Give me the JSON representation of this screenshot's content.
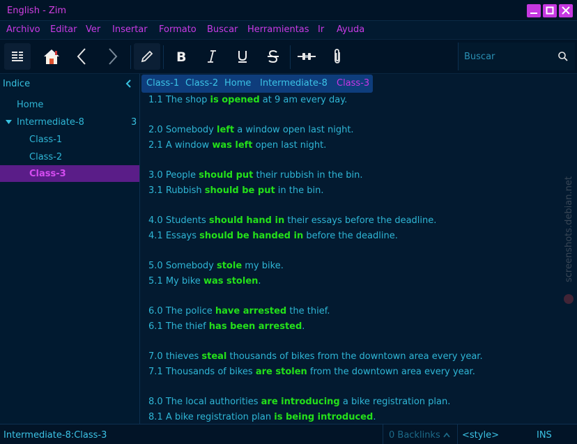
{
  "window": {
    "title": "English - Zim"
  },
  "menu": [
    "Archivo",
    "Editar",
    "Ver",
    "Insertar",
    "Formato",
    "Buscar",
    "Herramientas",
    "Ir",
    "Ayuda"
  ],
  "search": {
    "placeholder": "Buscar"
  },
  "sidebar": {
    "title": "Indice",
    "items": [
      {
        "label": "Home"
      },
      {
        "label": "Intermediate-8",
        "count": "3"
      },
      {
        "label": "Class-1"
      },
      {
        "label": "Class-2"
      },
      {
        "label": "Class-3"
      }
    ]
  },
  "pathbar": [
    "Class-1",
    "Class-2",
    "Home",
    "Intermediate-8",
    "Class-3"
  ],
  "content": {
    "lines": [
      {
        "id": "1.1",
        "pre": "The shop ",
        "b": "is opened",
        "post": " at 9 am every day."
      },
      {
        "id": "2.0",
        "pre": "Somebody ",
        "b": "left",
        "post": " a window open last night."
      },
      {
        "id": "2.1",
        "pre": "A window ",
        "b": "was left",
        "post": " open last night."
      },
      {
        "id": "3.0",
        "pre": "People ",
        "b": "should put",
        "post": " their rubbish in the bin."
      },
      {
        "id": "3.1",
        "pre": "Rubbish ",
        "b": "should be put",
        "post": " in the bin."
      },
      {
        "id": "4.0",
        "pre": "Students ",
        "b": "should hand in",
        "post": " their essays before the deadline."
      },
      {
        "id": "4.1",
        "pre": "Essays ",
        "b": "should be handed in",
        "post": " before the deadline."
      },
      {
        "id": "5.0",
        "pre": "Somebody ",
        "b": "stole",
        "post": " my bike."
      },
      {
        "id": "5.1",
        "pre": "My bike ",
        "b": "was stolen",
        "post": "."
      },
      {
        "id": "6.0",
        "pre": "The police ",
        "b": "have arrested",
        "post": " the thief."
      },
      {
        "id": "6.1",
        "pre": "The thief ",
        "b": "has been arrested",
        "post": "."
      },
      {
        "id": "7.0",
        "pre": "thieves ",
        "b": "steal",
        "post": " thousands of bikes from the downtown area every year."
      },
      {
        "id": "7.1",
        "pre": "Thousands of bikes ",
        "b": "are stolen",
        "post": " from the downtown area every year."
      },
      {
        "id": "8.0",
        "pre": "The local authorities ",
        "b": "are introducing",
        "post": " a bike registration plan."
      },
      {
        "id": "8.1",
        "pre": "A bike registration plan ",
        "b": "is being introduced",
        "post": "."
      }
    ]
  },
  "watermark": "screenshots.debian.net",
  "status": {
    "path": "Intermediate-8:Class-3",
    "backlinks": "0 Backlinks",
    "style": "<style>",
    "mode": "INS"
  },
  "colors": {
    "accent": "#c93ae6",
    "text": "#2fb6d6",
    "bold": "#24e01a",
    "selection": "#5a1d88",
    "background": "#031a30"
  }
}
